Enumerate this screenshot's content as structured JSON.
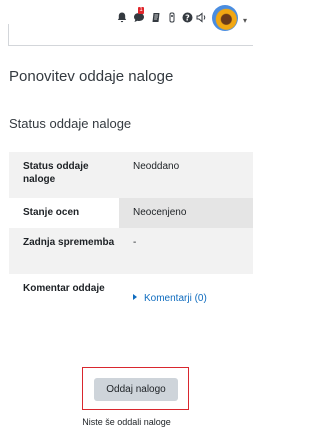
{
  "topbar": {
    "icons": [
      "bell-icon",
      "chat-icon",
      "document-icon",
      "toggle-icon",
      "help-icon",
      "sound-icon"
    ],
    "notification_count": "1",
    "avatar": "user-avatar"
  },
  "page_title": "Ponovitev oddaje naloge",
  "status_heading": "Status oddaje naloge",
  "status_table": {
    "rows": [
      {
        "label": "Status oddaje naloge",
        "value": "Neoddano"
      },
      {
        "label": "Stanje ocen",
        "value": "Neocenjeno"
      },
      {
        "label": "Zadnja sprememba",
        "value": "-"
      },
      {
        "label": "Komentar oddaje",
        "value": "Komentarji (0)"
      }
    ]
  },
  "submit": {
    "button_label": "Oddaj nalogo",
    "note": "Niste še oddali naloge"
  },
  "colors": {
    "link": "#0f6cbf",
    "notification_badge": "#e0262b",
    "highlight_border": "#d9272e",
    "button_bg": "#ced4da"
  }
}
